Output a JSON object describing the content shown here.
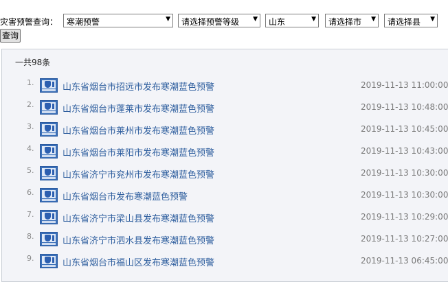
{
  "filter": {
    "label": "灾害预警查询：",
    "type_select": "寒潮预警",
    "level_select": "请选择预警等级",
    "province_select": "山东",
    "city_select": "请选择市",
    "county_select": "请选择县",
    "query_button": "查询"
  },
  "results": {
    "count_text": "一共98条",
    "items": [
      {
        "num": "1.",
        "title": "山东省烟台市招远市发布寒潮蓝色预警",
        "time": "2019-11-13 11:00:00"
      },
      {
        "num": "2.",
        "title": "山东省烟台市蓬莱市发布寒潮蓝色预警",
        "time": "2019-11-13 10:48:00"
      },
      {
        "num": "3.",
        "title": "山东省烟台市莱州市发布寒潮蓝色预警",
        "time": "2019-11-13 10:45:00"
      },
      {
        "num": "4.",
        "title": "山东省烟台市莱阳市发布寒潮蓝色预警",
        "time": "2019-11-13 10:43:00"
      },
      {
        "num": "5.",
        "title": "山东省济宁市兖州市发布寒潮蓝色预警",
        "time": "2019-11-13 10:30:00"
      },
      {
        "num": "6.",
        "title": "山东省烟台市发布寒潮蓝色预警",
        "time": "2019-11-13 10:30:00"
      },
      {
        "num": "7.",
        "title": "山东省济宁市梁山县发布寒潮蓝色预警",
        "time": "2019-11-13 10:29:00"
      },
      {
        "num": "8.",
        "title": "山东省济宁市泗水县发布寒潮蓝色预警",
        "time": "2019-11-13 10:27:00"
      },
      {
        "num": "9.",
        "title": "山东省烟台市福山区发布寒潮蓝色预警",
        "time": "2019-11-13 06:45:00"
      }
    ]
  },
  "icon": "blue-cold-wave-warning-icon",
  "colors": {
    "link": "#2e5e9e",
    "panel_bg": "#f3f4f8",
    "icon_blue": "#3a6fb8"
  }
}
